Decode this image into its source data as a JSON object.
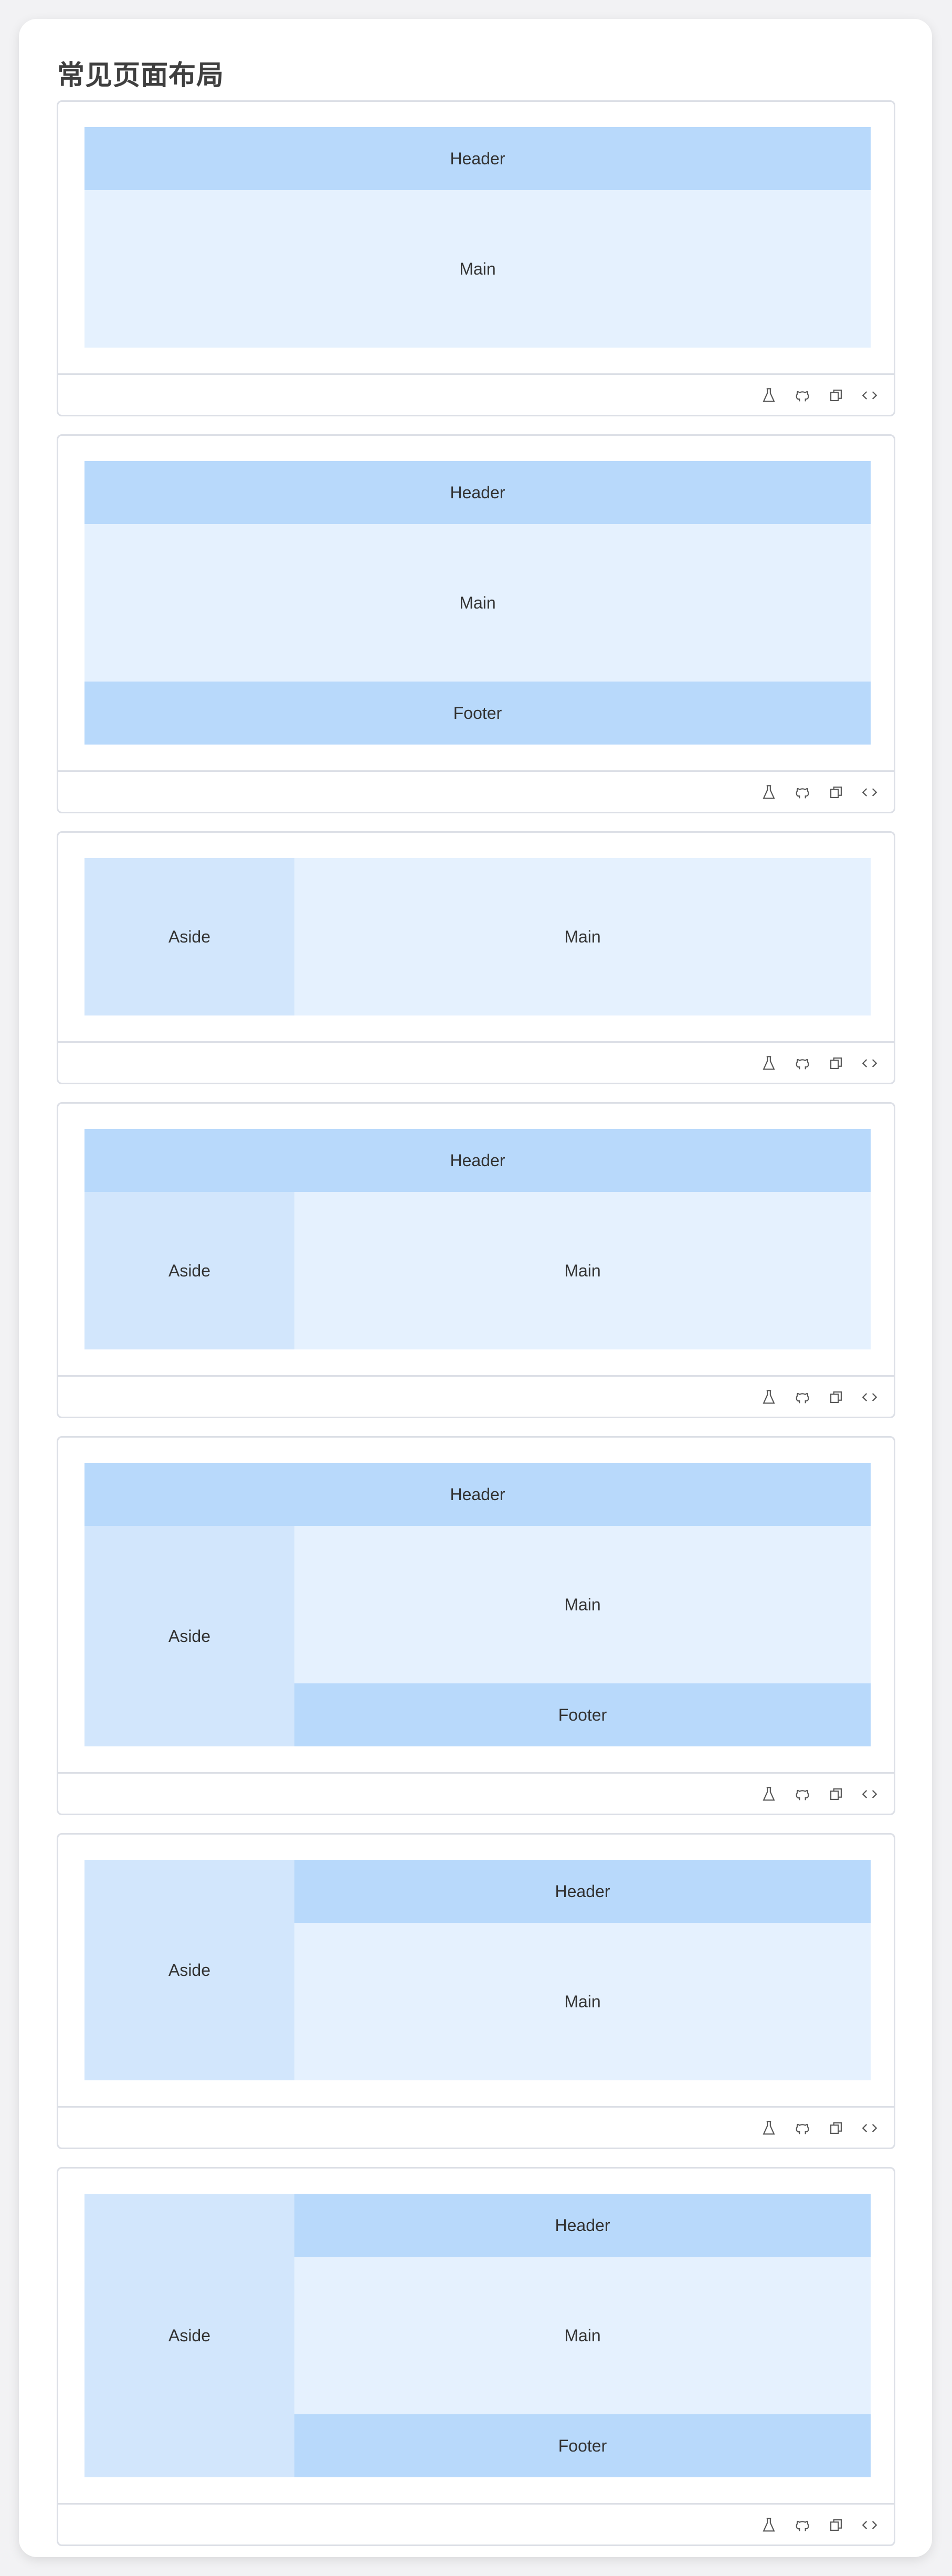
{
  "page": {
    "title": "常见页面布局"
  },
  "labels": {
    "header": "Header",
    "main": "Main",
    "footer": "Footer",
    "aside": "Aside"
  },
  "toolbar": {
    "icons": [
      "flask-icon",
      "github-icon",
      "copy-icon",
      "code-icon"
    ]
  },
  "colors": {
    "header_footer": "#b8d9fb",
    "main": "#e5f1fe",
    "aside": "#d2e6fc",
    "border": "#dcdfe6"
  },
  "examples": [
    {
      "layout": "header-main"
    },
    {
      "layout": "header-main-footer"
    },
    {
      "layout": "aside-main"
    },
    {
      "layout": "header-aside-main"
    },
    {
      "layout": "header-aside-main-footer"
    },
    {
      "layout": "aside-header-main"
    },
    {
      "layout": "aside-header-main-footer"
    }
  ]
}
